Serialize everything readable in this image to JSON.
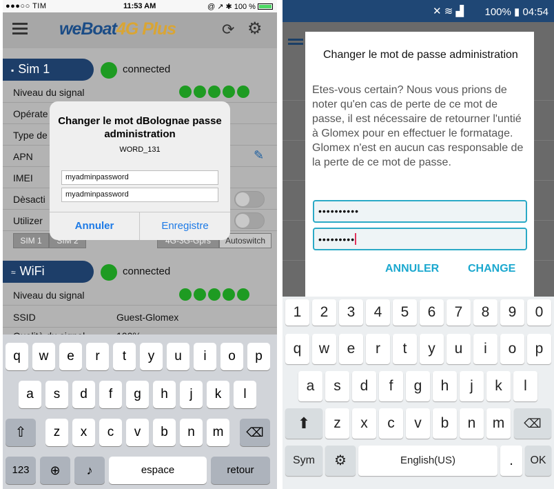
{
  "ios": {
    "status": {
      "carrier": "●●●○○ TIM",
      "time": "11:53 AM",
      "right": "@ ↗ ✱ 100 %"
    },
    "app": {
      "logo_a": "weBoat",
      "logo_b": "4G Plus"
    },
    "sim": {
      "title": "Sim 1",
      "status": "connected",
      "rows": [
        {
          "label": "Niveau du signal",
          "value": ""
        },
        {
          "label": "Opérate",
          "value": ""
        },
        {
          "label": "Type de",
          "value": ""
        },
        {
          "label": "APN",
          "value": ""
        },
        {
          "label": "IMEI",
          "value": ""
        },
        {
          "label": "Dèsacti",
          "value": ""
        },
        {
          "label": "Utilizer",
          "value": ""
        }
      ],
      "segments": {
        "sim1": "SIM 1",
        "sim2": "SIM 2",
        "mode": "4G-3G-Gprs",
        "auto": "Autoswitch"
      }
    },
    "wifi": {
      "title": "WiFi",
      "status": "connected",
      "rows": [
        {
          "label": "Niveau du signal",
          "value": ""
        },
        {
          "label": "SSID",
          "value": "Guest-Glomex"
        },
        {
          "label": "Qualità du signal",
          "value": "100%"
        }
      ]
    },
    "dialog": {
      "title": "Changer le mot dBolognae passe administration",
      "subtitle": "WORD_131",
      "field1": "myadminpassword",
      "field2": "myadminpassword",
      "cancel": "Annuler",
      "save": "Enregistre"
    },
    "keyboard": {
      "row1": [
        "q",
        "w",
        "e",
        "r",
        "t",
        "y",
        "u",
        "i",
        "o",
        "p"
      ],
      "row2": [
        "a",
        "s",
        "d",
        "f",
        "g",
        "h",
        "j",
        "k",
        "l"
      ],
      "row3": [
        "z",
        "x",
        "c",
        "v",
        "b",
        "n",
        "m"
      ],
      "numbers": "123",
      "space": "espace",
      "return": "retour"
    }
  },
  "android": {
    "status": {
      "right": "100% ▮ 04:54"
    },
    "dialog": {
      "title": "Changer le mot de passe administration",
      "message": "Etes-vous certain? Nous vous prions de noter qu'en cas de perte de ce mot de passe, il est nécessaire de retourner l'untié à Glomex pour en effectuer le formatage. Glomex n'est en aucun cas responsable de la perte de ce mot de passe.",
      "field1": "••••••••••",
      "field2": "•••••••••",
      "cancel": "ANNULER",
      "confirm": "CHANGE"
    },
    "keyboard": {
      "digits": [
        "1",
        "2",
        "3",
        "4",
        "5",
        "6",
        "7",
        "8",
        "9",
        "0"
      ],
      "row1": [
        "q",
        "w",
        "e",
        "r",
        "t",
        "y",
        "u",
        "i",
        "o",
        "p"
      ],
      "row2": [
        "a",
        "s",
        "d",
        "f",
        "g",
        "h",
        "j",
        "k",
        "l"
      ],
      "row3": [
        "z",
        "x",
        "c",
        "v",
        "b",
        "n",
        "m"
      ],
      "sym": "Sym",
      "space": "English(US)",
      "ok": "OK"
    }
  }
}
